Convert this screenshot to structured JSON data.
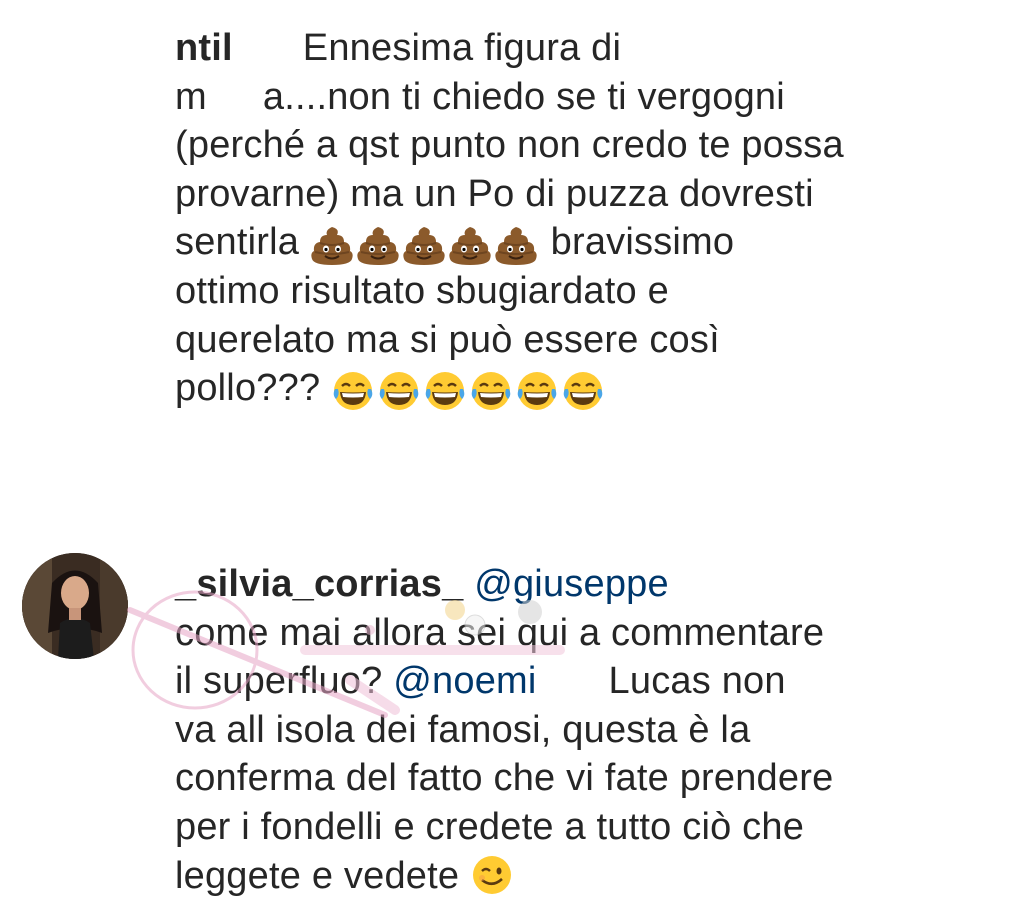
{
  "comment_1": {
    "username": "ntil",
    "lines": [
      "Ennesima figura di",
      "m",
      "a....non ti chiedo se ti vergogni",
      "(perché a qst punto non credo te possa",
      "provarne) ma un Po di puzza dovresti",
      "sentirla",
      "bravissimo",
      "ottimo risultato sbugiardato e",
      "querelato ma si può essere così",
      "pollo???"
    ],
    "poop_emoji_count": 5,
    "laugh_emoji_count": 6,
    "emoji_icons": [
      "pile-of-poo-emoji",
      "tears-of-joy-emoji"
    ]
  },
  "comment_2": {
    "username": "_silvia_corrias_",
    "mention_1": "@giuseppe",
    "lines": [
      "come mai allora sei qui a commentare",
      "il superfluo?",
      "Lucas non",
      "va all isola dei famosi, questa è la",
      "conferma del fatto che vi fate prendere",
      "per i fondelli e credete a tutto ciò che",
      "leggete e vedete"
    ],
    "mention_2": "@noemi",
    "end_emoji": "winking-face-emoji"
  },
  "colors": {
    "text": "#262626",
    "mention": "#00376b",
    "background": "#ffffff"
  }
}
